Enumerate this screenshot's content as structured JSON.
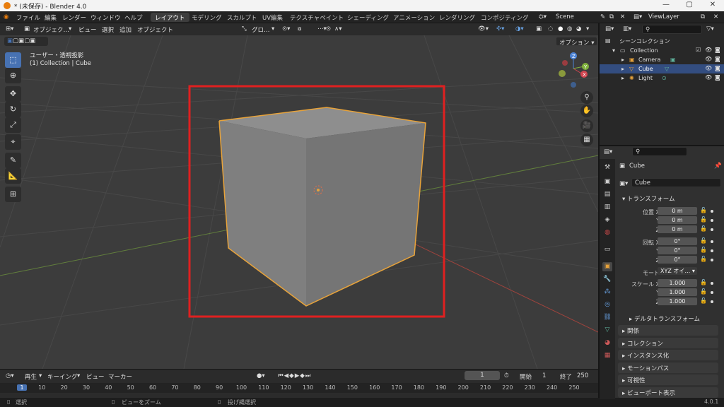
{
  "window": {
    "title": "* (未保存) - Blender 4.0",
    "minimize": "—",
    "maximize": "▢",
    "close": "✕"
  },
  "menu": {
    "items": [
      "ファイル",
      "編集",
      "レンダー",
      "ウィンドウ",
      "ヘルプ"
    ]
  },
  "workspaces": [
    "レイアウト",
    "モデリング",
    "スカルプト",
    "UV編集",
    "テクスチャペイント",
    "シェーディング",
    "アニメーション",
    "レンダリング",
    "コンポジティング"
  ],
  "scene": {
    "name": "Scene",
    "view_layer": "ViewLayer"
  },
  "viewport_header": {
    "mode": "オブジェク…",
    "menus": [
      "ビュー",
      "選択",
      "追加",
      "オブジェクト"
    ],
    "transform_orientation": "グロ…",
    "options": "オプション"
  },
  "viewport": {
    "view_name": "ユーザー・透視投影",
    "context": "(1) Collection | Cube",
    "axes": {
      "x": "X",
      "y": "Y",
      "z": "Z"
    }
  },
  "tools": [
    "select-box",
    "cursor",
    "move",
    "rotate",
    "scale",
    "transform",
    "annotate",
    "measure",
    "add-cube"
  ],
  "outliner": {
    "title": "シーンコレクション",
    "items": [
      {
        "name": "Collection",
        "type": "collection",
        "selected": false
      },
      {
        "name": "Camera",
        "type": "camera",
        "selected": false
      },
      {
        "name": "Cube",
        "type": "mesh",
        "selected": true
      },
      {
        "name": "Light",
        "type": "light",
        "selected": false
      }
    ]
  },
  "properties": {
    "object_name": "Cube",
    "data_name": "Cube",
    "transform_title": "トランスフォーム",
    "location_label": "位置 X",
    "location": [
      "0 m",
      "0 m",
      "0 m"
    ],
    "rotation_label": "回転 X",
    "rotation": [
      "0°",
      "0°",
      "0°"
    ],
    "mode_label": "モード",
    "mode_value": "XYZ オイ…",
    "scale_label": "スケール X",
    "scale": [
      "1.000",
      "1.000",
      "1.000"
    ],
    "axis_y": "Y",
    "axis_z": "Z",
    "delta_title": "デルタトランスフォーム",
    "sections": [
      "関係",
      "コレクション",
      "インスタンス化",
      "モーションパス",
      "可視性",
      "ビューポート表示"
    ]
  },
  "timeline": {
    "menus": [
      "再生",
      "キーイング",
      "ビュー",
      "マーカー"
    ],
    "current_frame": "1",
    "start_label": "開始",
    "start": "1",
    "end_label": "終了",
    "end": "250",
    "ruler": [
      "1",
      "10",
      "20",
      "30",
      "40",
      "50",
      "60",
      "70",
      "80",
      "90",
      "100",
      "110",
      "120",
      "130",
      "140",
      "150",
      "160",
      "170",
      "180",
      "190",
      "200",
      "210",
      "220",
      "230",
      "240",
      "250"
    ]
  },
  "statusbar": {
    "left": "選択",
    "middle": "ビューをズーム",
    "right": "投げ縄選択",
    "version": "4.0.1"
  },
  "colors": {
    "accent": "#4772b3",
    "selection_outline": "#e8a33a",
    "highlight_rect": "#e02020",
    "x_axis": "#c8463c",
    "y_axis": "#7bab3c"
  }
}
